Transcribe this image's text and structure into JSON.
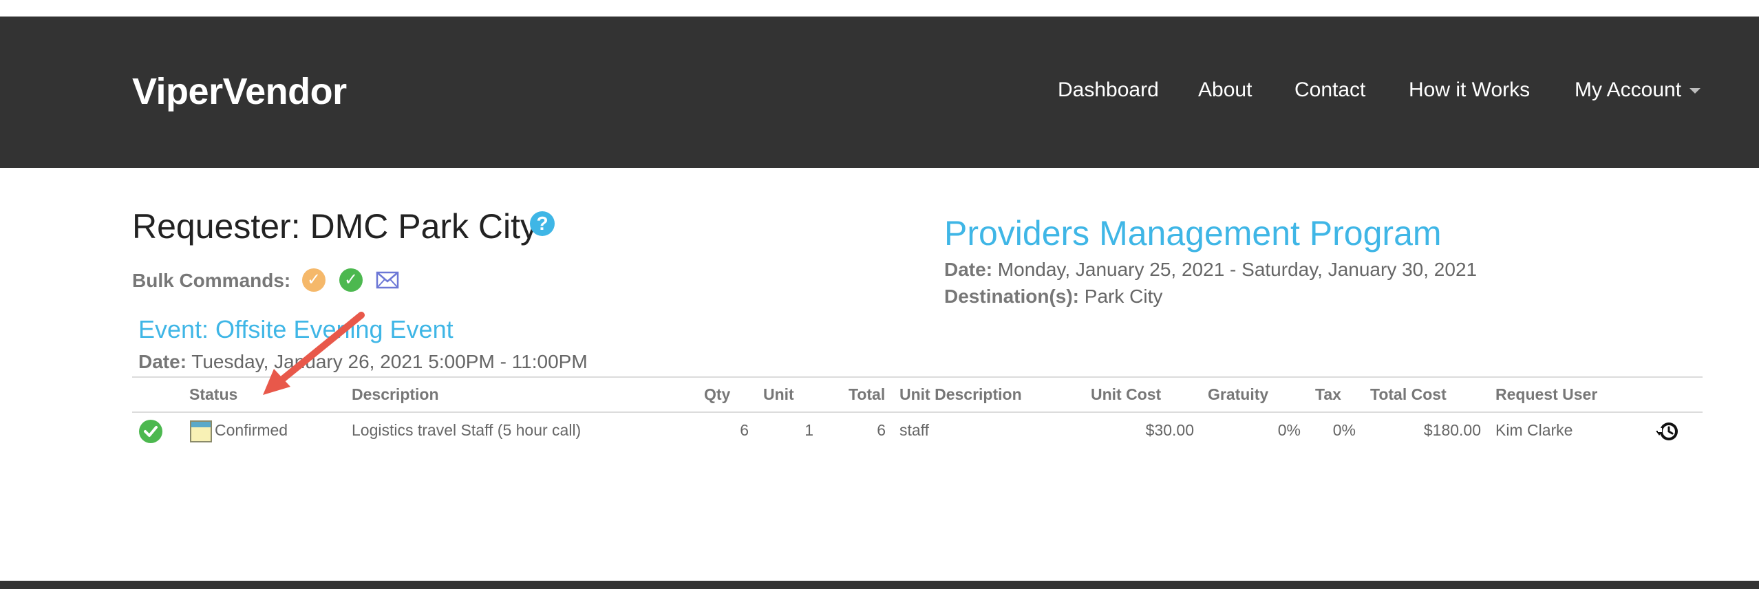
{
  "header": {
    "brand": "ViperVendor",
    "nav": [
      "Dashboard",
      "About",
      "Contact",
      "How it Works",
      "My Account"
    ]
  },
  "requester": {
    "label": "Requester: DMC Park City"
  },
  "bulk": {
    "label": "Bulk Commands:"
  },
  "program": {
    "title": "Providers Management Program",
    "date_label": "Date:",
    "date_value": " Monday, January 25, 2021 - Saturday, January 30, 2021",
    "dest_label": "Destination(s):",
    "dest_value": " Park City"
  },
  "event": {
    "title": "Event: Offsite Evening Event",
    "date_label": "Date:",
    "date_value": " Tuesday, January 26, 2021 5:00PM - 11:00PM"
  },
  "table": {
    "headers": {
      "status": "Status",
      "description": "Description",
      "qty": "Qty",
      "unit": "Unit",
      "total": "Total",
      "unit_description": "Unit Description",
      "unit_cost": "Unit Cost",
      "gratuity": "Gratuity",
      "tax": "Tax",
      "total_cost": "Total Cost",
      "request_user": "Request User"
    },
    "rows": [
      {
        "status": "Confirmed",
        "description": "Logistics travel Staff (5 hour call)",
        "qty": "6",
        "unit": "1",
        "total": "6",
        "unit_description": "staff",
        "unit_cost": "$30.00",
        "gratuity": "0%",
        "tax": "0%",
        "total_cost": "$180.00",
        "request_user": "Kim Clarke"
      }
    ]
  },
  "icons": {
    "help": "question-icon",
    "bulk_pending": "check-circle-orange-icon",
    "bulk_confirm": "check-circle-green-icon",
    "bulk_email": "envelope-icon",
    "row_status": "check-circle-green-icon",
    "row_note": "note-icon",
    "row_history": "history-icon"
  },
  "colors": {
    "navbar": "#333333",
    "accent": "#3fb6e6",
    "confirm_green": "#4cb84f",
    "pending_orange": "#f5b86a",
    "annotation_arrow": "#e8584a"
  }
}
